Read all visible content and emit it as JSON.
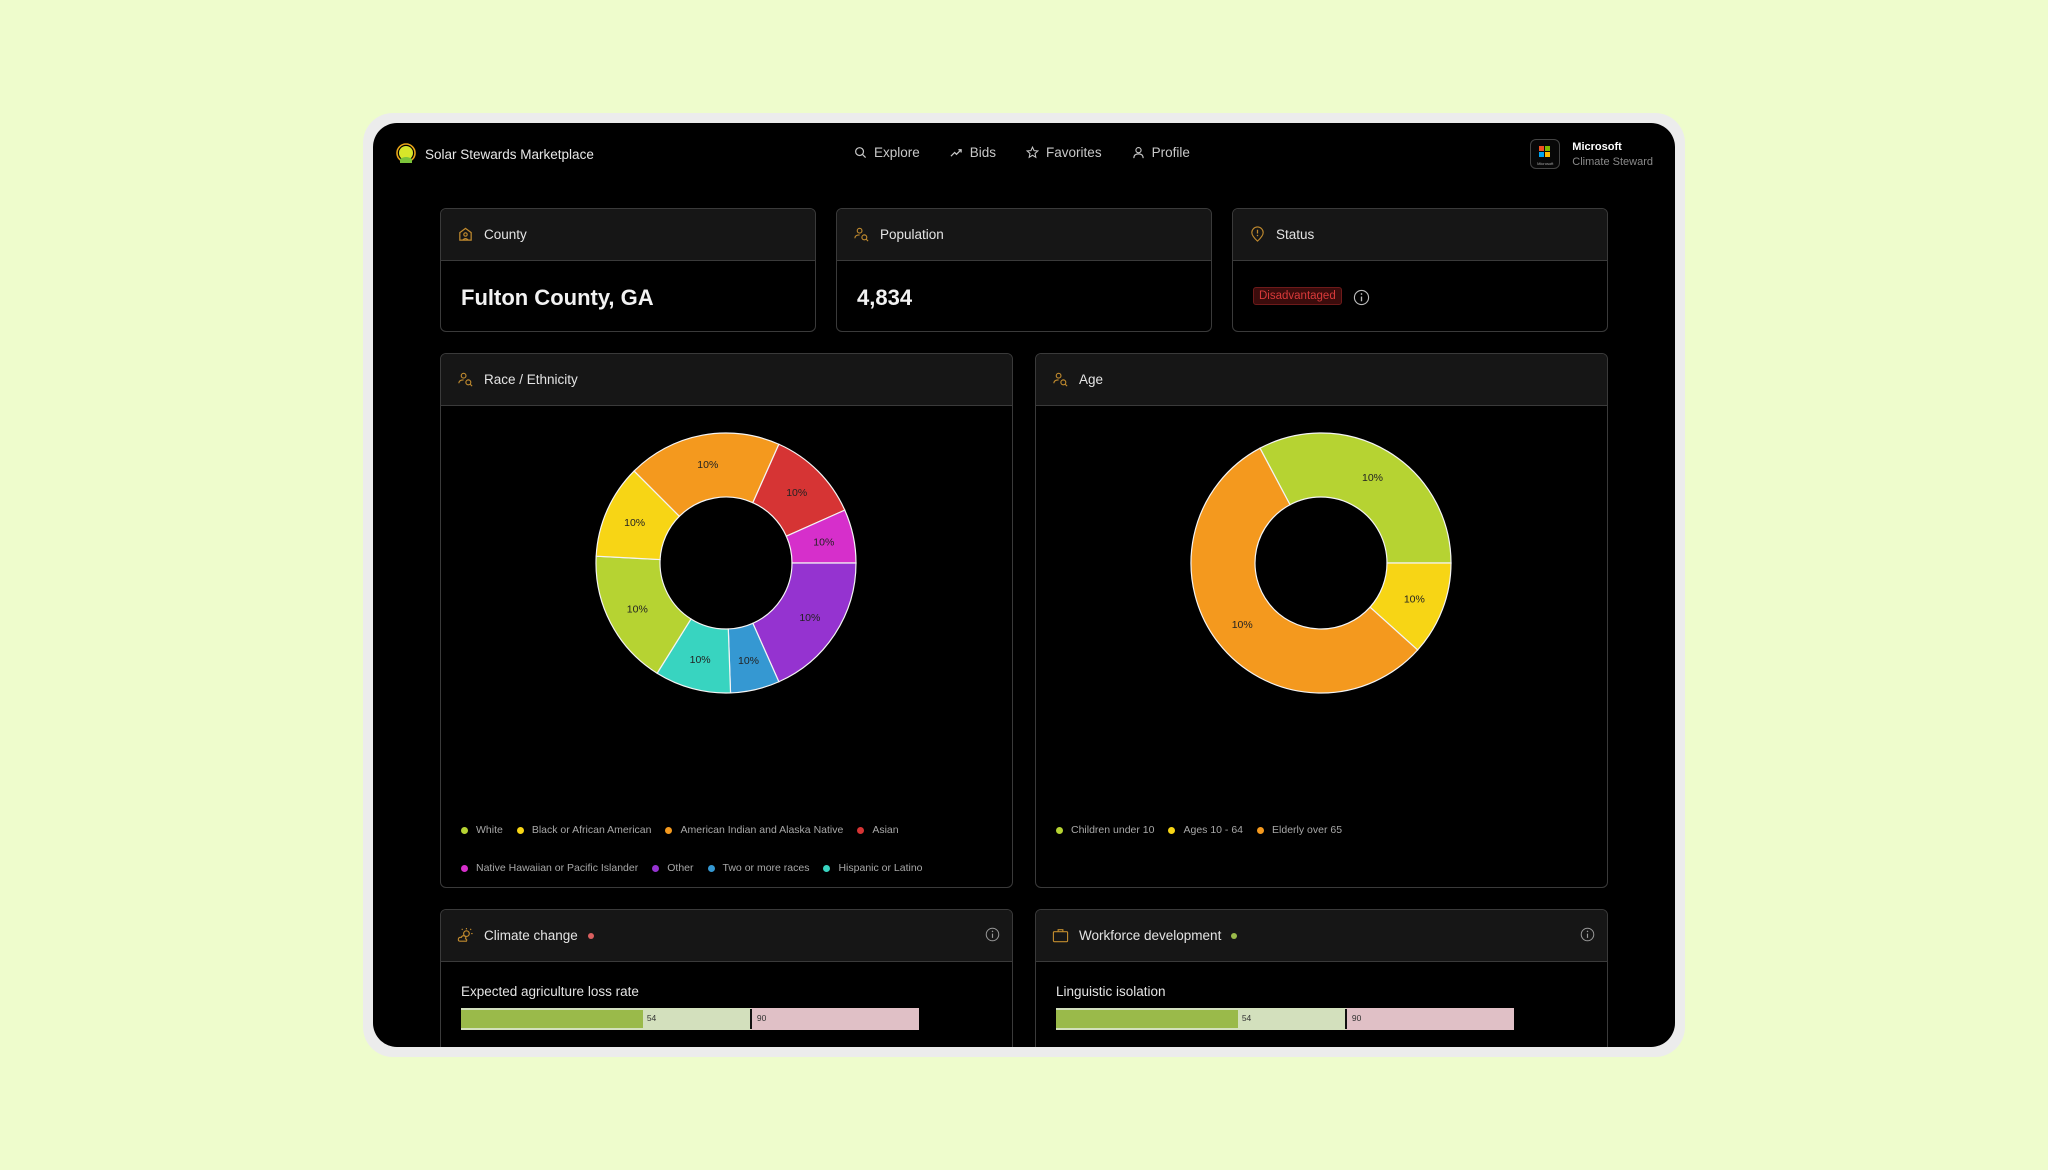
{
  "app": {
    "title": "Solar Stewards Marketplace"
  },
  "nav": {
    "items": [
      {
        "label": "Explore",
        "icon": "search-icon"
      },
      {
        "label": "Bids",
        "icon": "trend-icon"
      },
      {
        "label": "Favorites",
        "icon": "star-icon"
      },
      {
        "label": "Profile",
        "icon": "user-icon"
      }
    ]
  },
  "account": {
    "org": "Microsoft",
    "role": "Climate Steward",
    "logo_caption": "Microsoft"
  },
  "stats": {
    "county": {
      "label": "County",
      "value": "Fulton County, GA",
      "icon": "home-pin-icon"
    },
    "population": {
      "label": "Population",
      "value": "4,834",
      "icon": "user-search-icon"
    },
    "status": {
      "label": "Status",
      "value": "Disadvantaged",
      "icon": "alert-pin-icon"
    }
  },
  "race_card": {
    "title": "Race / Ethnicity",
    "icon": "user-search-icon"
  },
  "age_card": {
    "title": "Age",
    "icon": "user-search-icon"
  },
  "chart_data": [
    {
      "type": "pie",
      "title": "Race / Ethnicity",
      "donut": true,
      "start_angle_deg": 315,
      "legend_position": "bottom",
      "slices": [
        {
          "name": "American Indian and Alaska Native",
          "sweep_deg": 69,
          "label": "10%",
          "color": "#f4991e"
        },
        {
          "name": "Asian",
          "sweep_deg": 42,
          "label": "10%",
          "color": "#d63434"
        },
        {
          "name": "Native Hawaiian or Pacific Islander",
          "sweep_deg": 24,
          "label": "10%",
          "color": "#d62fcb"
        },
        {
          "name": "Other",
          "sweep_deg": 66,
          "label": "10%",
          "color": "#9533d0"
        },
        {
          "name": "Two or more races",
          "sweep_deg": 22,
          "label": "10%",
          "color": "#3598d2"
        },
        {
          "name": "Hispanic or Latino",
          "sweep_deg": 34,
          "label": "10%",
          "color": "#38d4c0"
        },
        {
          "name": "White",
          "sweep_deg": 61,
          "label": "10%",
          "color": "#b6d332"
        },
        {
          "name": "Black or African American",
          "sweep_deg": 42,
          "label": "10%",
          "color": "#f7d515"
        }
      ],
      "legend": [
        {
          "name": "White",
          "color": "#b6d332"
        },
        {
          "name": "Black or African American",
          "color": "#f7d515"
        },
        {
          "name": "American Indian and Alaska Native",
          "color": "#f4991e"
        },
        {
          "name": "Asian",
          "color": "#d63434"
        },
        {
          "name": "Native Hawaiian or Pacific Islander",
          "color": "#d62fcb"
        },
        {
          "name": "Other",
          "color": "#9533d0"
        },
        {
          "name": "Two or more races",
          "color": "#3598d2"
        },
        {
          "name": "Hispanic or Latino",
          "color": "#38d4c0"
        }
      ]
    },
    {
      "type": "pie",
      "title": "Age",
      "donut": true,
      "start_angle_deg": 332,
      "legend_position": "bottom",
      "slices": [
        {
          "name": "Children under 10",
          "sweep_deg": 118,
          "label": "10%",
          "color": "#b6d332"
        },
        {
          "name": "Ages 10 - 64",
          "sweep_deg": 42,
          "label": "10%",
          "color": "#f7d515"
        },
        {
          "name": "Elderly over 65",
          "sweep_deg": 200,
          "label": "10%",
          "color": "#f4991e"
        }
      ],
      "legend": [
        {
          "name": "Children under 10",
          "color": "#b6d332"
        },
        {
          "name": "Ages 10 - 64",
          "color": "#f7d515"
        },
        {
          "name": "Elderly over 65",
          "color": "#f4991e"
        }
      ]
    }
  ],
  "indicators": [
    {
      "title": "Climate change",
      "icon": "sun-cloud-icon",
      "status_color": "#d95f5f",
      "metric": "Expected agriculture loss rate",
      "value": 54,
      "threshold": 90,
      "value_label": "54",
      "threshold_label": "90",
      "value_fraction": 0.397,
      "threshold_fraction": 0.633
    },
    {
      "title": "Workforce development",
      "icon": "briefcase-icon",
      "status_color": "#9aba4a",
      "metric": "Linguistic isolation",
      "value": 54,
      "threshold": 90,
      "value_label": "54",
      "threshold_label": "90",
      "value_fraction": 0.397,
      "threshold_fraction": 0.633
    }
  ],
  "colors": {
    "icon_accent": "#c08a2e",
    "page_bg": "#eefccc"
  }
}
